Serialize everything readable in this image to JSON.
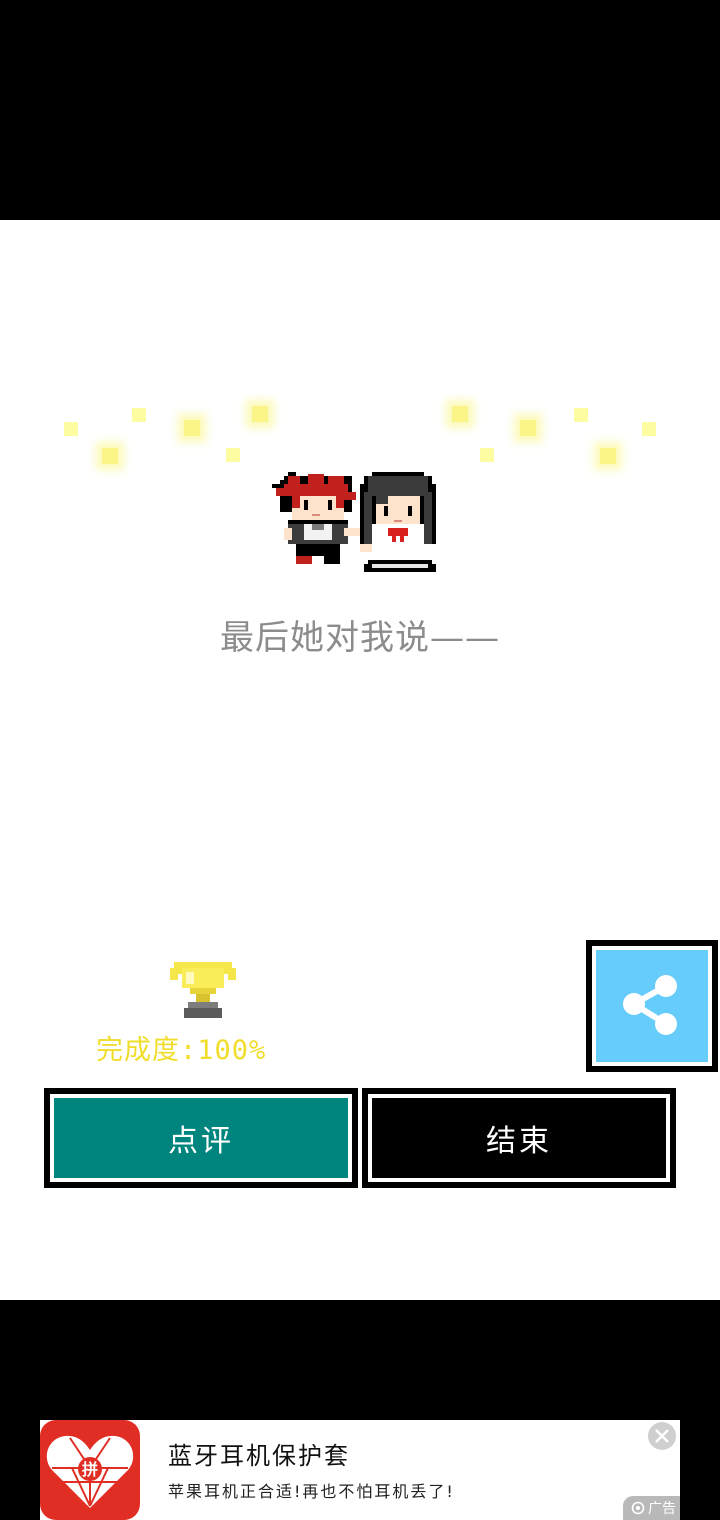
{
  "game": {
    "ending_text": "最后她对我说——",
    "completion_label": "完成度:100%",
    "completion_percent": 100,
    "review_label": "点评",
    "end_label": "结束",
    "trophy_icon": "trophy-icon",
    "share_icon": "share-icon"
  },
  "colors": {
    "review_button": "#00847e",
    "end_button": "#000000",
    "share_button": "#66ccfb",
    "completion_text": "#f1dd2b",
    "ending_text": "#8c8c8c"
  },
  "ad": {
    "title": "蓝牙耳机保护套",
    "subtitle": "苹果耳机正合适!再也不怕耳机丢了!",
    "badge": "广告",
    "logo_text": "拼",
    "close_icon": "close-icon",
    "brand_color": "#e02e24"
  }
}
